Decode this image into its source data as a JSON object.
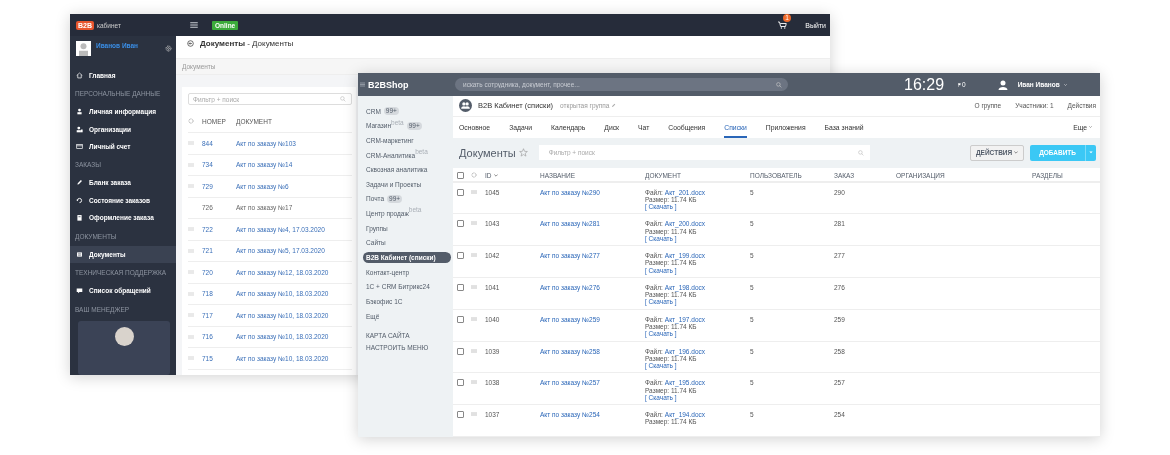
{
  "left_window": {
    "top_bar": {
      "logo": "B2B",
      "logo_caption": "кабинет",
      "status_badge": "Online",
      "cart_count": "1",
      "logout": "Выйти"
    },
    "profile": {
      "name": "Иванов Иван"
    },
    "nav": [
      {
        "kind": "item",
        "label": "Главная",
        "selected": false
      },
      {
        "kind": "section",
        "label": "ПЕРСОНАЛЬНЫЕ ДАННЫЕ"
      },
      {
        "kind": "item",
        "label": "Личная информация",
        "selected": false
      },
      {
        "kind": "item",
        "label": "Организации",
        "selected": false
      },
      {
        "kind": "item",
        "label": "Личный счет",
        "selected": false
      },
      {
        "kind": "section",
        "label": "ЗАКАЗЫ"
      },
      {
        "kind": "item",
        "label": "Бланк заказа",
        "selected": false
      },
      {
        "kind": "item",
        "label": "Состояние заказов",
        "selected": false
      },
      {
        "kind": "item",
        "label": "Оформление заказа",
        "selected": false
      },
      {
        "kind": "section",
        "label": "ДОКУМЕНТЫ"
      },
      {
        "kind": "item",
        "label": "Документы",
        "selected": true
      },
      {
        "kind": "section",
        "label": "ТЕХНИЧЕСКАЯ ПОДДЕРЖКА"
      },
      {
        "kind": "item",
        "label": "Список обращений",
        "selected": false
      },
      {
        "kind": "section",
        "label": "ВАШ МЕНЕДЖЕР"
      }
    ],
    "page_title": "**Документы** - Документы",
    "breadcrumb": "Документы",
    "filter": {
      "placeholder": "Фильтр + поиск"
    },
    "columns": [
      "НОМЕР",
      "ДОКУМЕНТ"
    ],
    "rows": [
      {
        "number": "844",
        "document": "Акт по заказу №103",
        "disabled": false
      },
      {
        "number": "734",
        "document": "Акт по заказу №14",
        "disabled": false
      },
      {
        "number": "729",
        "document": "Акт по заказу №6",
        "disabled": false
      },
      {
        "number": "726",
        "document": "Акт по заказу №17",
        "disabled": true
      },
      {
        "number": "722",
        "document": "Акт по заказу №4, 17.03.2020",
        "disabled": false
      },
      {
        "number": "721",
        "document": "Акт по заказу №5, 17.03.2020",
        "disabled": false
      },
      {
        "number": "720",
        "document": "Акт по заказу №12, 18.03.2020",
        "disabled": false
      },
      {
        "number": "718",
        "document": "Акт по заказу №10, 18.03.2020",
        "disabled": false
      },
      {
        "number": "717",
        "document": "Акт по заказу №10, 18.03.2020",
        "disabled": false
      },
      {
        "number": "716",
        "document": "Акт по заказу №10, 18.03.2020",
        "disabled": false
      },
      {
        "number": "715",
        "document": "Акт по заказу №10, 18.03.2020",
        "disabled": false
      }
    ]
  },
  "right_window": {
    "top_bar": {
      "logo": "B2BShop",
      "search": {
        "placeholder": "искать сотрудника, документ, прочее..."
      },
      "time": "16:29",
      "notifications": "0",
      "user": "Иван Иванов"
    },
    "sidebar": {
      "items": [
        {
          "label": "CRM",
          "counter": "99+",
          "selected": false
        },
        {
          "label": "Магазин",
          "sup": "beta",
          "counter": "99+",
          "selected": false
        },
        {
          "label": "CRM-маркетинг",
          "selected": false
        },
        {
          "label": "CRM-Аналитика",
          "sup": "beta",
          "selected": false
        },
        {
          "label": "Сквозная аналитика",
          "selected": false
        },
        {
          "label": "Задачи и Проекты",
          "selected": false
        },
        {
          "label": "Почта",
          "counter": "99+",
          "selected": false
        },
        {
          "label": "Центр продаж",
          "sup": "beta",
          "selected": false
        },
        {
          "label": "Группы",
          "selected": false
        },
        {
          "label": "Сайты",
          "selected": false
        },
        {
          "label": "B2B Кабинет (списки)",
          "selected": true
        },
        {
          "label": "Контакт-центр",
          "selected": false
        },
        {
          "label": "1С + CRM Битрикс24",
          "selected": false
        },
        {
          "label": "Бэкофис 1С",
          "selected": false
        },
        {
          "label": "Ещё",
          "selected": false
        }
      ],
      "links": [
        "КАРТА САЙТА",
        "НАСТРОИТЬ МЕНЮ"
      ]
    },
    "group": {
      "title": "B2B Кабинет (списки)",
      "type": "открытая группа",
      "links": [
        "О группе",
        "Участники: 1",
        "Действия"
      ]
    },
    "tabs": [
      {
        "label": "Основное",
        "selected": false
      },
      {
        "label": "Задачи",
        "selected": false
      },
      {
        "label": "Календарь",
        "selected": false
      },
      {
        "label": "Диск",
        "selected": false
      },
      {
        "label": "Чат",
        "selected": false
      },
      {
        "label": "Сообщения",
        "selected": false
      },
      {
        "label": "Списки",
        "selected": true
      },
      {
        "label": "Приложения",
        "selected": false
      },
      {
        "label": "База знаний",
        "selected": false
      }
    ],
    "more_tab": "Еще",
    "list": {
      "title": "Документы",
      "filter": {
        "placeholder": "Фильтр + поиск"
      },
      "actions_button": "ДЕЙСТВИЯ",
      "add_button": "ДОБАВИТЬ"
    },
    "table": {
      "all_checked": false,
      "columns": [
        "ID",
        "НАЗВАНИЕ",
        "ДОКУМЕНТ",
        "ПОЛЬЗОВАТЕЛЬ",
        "ЗАКАЗ",
        "ОРГАНИЗАЦИЯ",
        "РАЗДЕЛЫ"
      ],
      "rows": [
        {
          "checked": false,
          "id": "1045",
          "name": "Акт по заказу №290",
          "file_label": "Файл:",
          "file": "Акт_201.docx",
          "size": "Размер: 11.74 КБ",
          "download": "[ Скачать ]",
          "user": "5",
          "order": "290"
        },
        {
          "checked": false,
          "id": "1043",
          "name": "Акт по заказу №281",
          "file_label": "Файл:",
          "file": "Акт_200.docx",
          "size": "Размер: 11.74 КБ",
          "download": "[ Скачать ]",
          "user": "5",
          "order": "281"
        },
        {
          "checked": false,
          "id": "1042",
          "name": "Акт по заказу №277",
          "file_label": "Файл:",
          "file": "Акт_199.docx",
          "size": "Размер: 11.74 КБ",
          "download": "[ Скачать ]",
          "user": "5",
          "order": "277"
        },
        {
          "checked": false,
          "id": "1041",
          "name": "Акт по заказу №276",
          "file_label": "Файл:",
          "file": "Акт_198.docx",
          "size": "Размер: 11.74 КБ",
          "download": "[ Скачать ]",
          "user": "5",
          "order": "276"
        },
        {
          "checked": false,
          "id": "1040",
          "name": "Акт по заказу №259",
          "file_label": "Файл:",
          "file": "Акт_197.docx",
          "size": "Размер: 11.74 КБ",
          "download": "[ Скачать ]",
          "user": "5",
          "order": "259"
        },
        {
          "checked": false,
          "id": "1039",
          "name": "Акт по заказу №258",
          "file_label": "Файл:",
          "file": "Акт_196.docx",
          "size": "Размер: 11.74 КБ",
          "download": "[ Скачать ]",
          "user": "5",
          "order": "258"
        },
        {
          "checked": false,
          "id": "1038",
          "name": "Акт по заказу №257",
          "file_label": "Файл:",
          "file": "Акт_195.docx",
          "size": "Размер: 11.74 КБ",
          "download": "[ Скачать ]",
          "user": "5",
          "order": "257"
        },
        {
          "checked": false,
          "id": "1037",
          "name": "Акт по заказу №254",
          "file_label": "Файл:",
          "file": "Акт_194.docx",
          "size": "Размер: 11.74 КБ",
          "user": "5",
          "order": "254"
        }
      ]
    }
  }
}
